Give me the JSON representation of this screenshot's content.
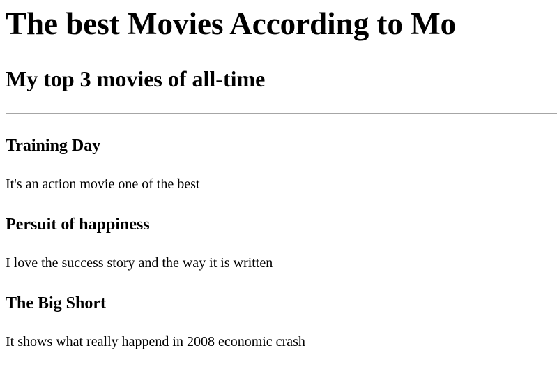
{
  "header": {
    "title": "The best Movies According to Mo",
    "subtitle": "My top 3 movies of all-time"
  },
  "movies": [
    {
      "title": "Training Day",
      "description": "It's an action movie one of the best"
    },
    {
      "title": "Persuit of happiness",
      "description": "I love the success story and the way it is written"
    },
    {
      "title": "The Big Short",
      "description": "It shows what really happend in 2008 economic crash"
    }
  ]
}
